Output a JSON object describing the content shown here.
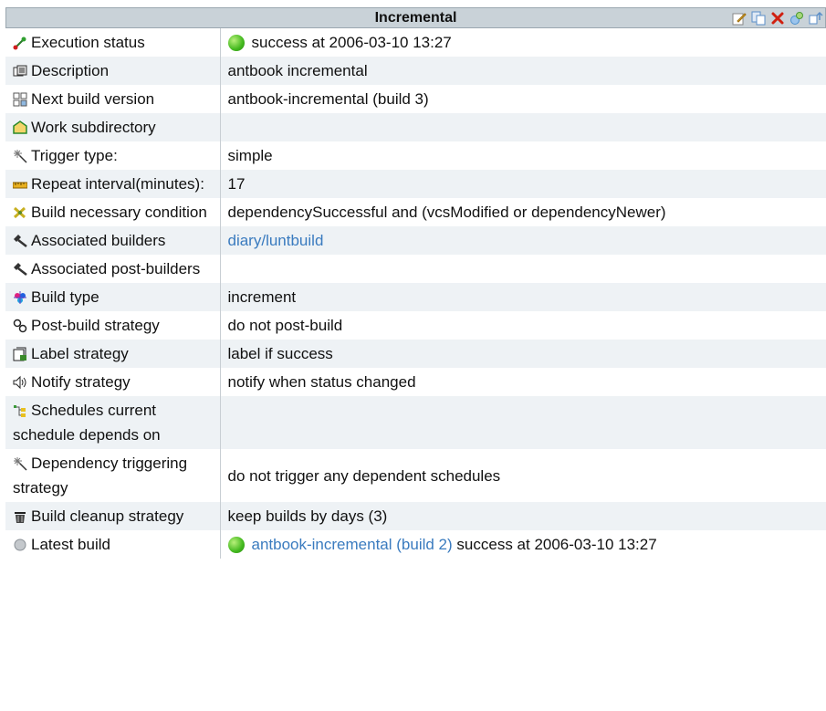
{
  "panel": {
    "title": "Incremental",
    "toolbar": [
      {
        "name": "edit-icon",
        "color": "#e8b83a"
      },
      {
        "name": "copy-icon",
        "color": "#5b8fc9"
      },
      {
        "name": "delete-icon",
        "color": "#d02010"
      },
      {
        "name": "build-icon",
        "color": "#4a90d0"
      },
      {
        "name": "move-icon",
        "color": "#5b8fc9"
      }
    ]
  },
  "rows": [
    {
      "label": "Execution status",
      "icon": "status-icon",
      "value_status": "success",
      "value": "success at 2006-03-10 13:27"
    },
    {
      "label": "Description",
      "icon": "description-icon",
      "value": "antbook incremental"
    },
    {
      "label": "Next build version",
      "icon": "version-icon",
      "value": "antbook-incremental (build 3)"
    },
    {
      "label": "Work subdirectory",
      "icon": "folder-icon",
      "value": ""
    },
    {
      "label": "Trigger type:",
      "icon": "trigger-icon",
      "value": "simple"
    },
    {
      "label": "Repeat interval(minutes):",
      "icon": "ruler-icon",
      "value": "17"
    },
    {
      "label": "Build necessary condition",
      "icon": "condition-icon",
      "value": "dependencySuccessful and (vcsModified or dependencyNewer)"
    },
    {
      "label": "Associated builders",
      "icon": "hammer-icon",
      "value": "diary/luntbuild",
      "value_is_link": true
    },
    {
      "label": "Associated post-builders",
      "icon": "hammer-icon",
      "value": ""
    },
    {
      "label": "Build type",
      "icon": "build-type-icon",
      "value": "increment"
    },
    {
      "label": "Post-build strategy",
      "icon": "gears-icon",
      "value": "do not post-build"
    },
    {
      "label": "Label strategy",
      "icon": "label-icon",
      "value": "label if success"
    },
    {
      "label": "Notify strategy",
      "icon": "speaker-icon",
      "value": "notify when status changed"
    },
    {
      "label": "Schedules current schedule depends on",
      "icon": "schedule-icon",
      "value": ""
    },
    {
      "label": "Dependency triggering strategy",
      "icon": "trigger-icon",
      "value": "do not trigger any dependent schedules"
    },
    {
      "label": "Build cleanup strategy",
      "icon": "trash-icon",
      "value": "keep builds by days (3)"
    },
    {
      "label": "Latest build",
      "icon": "latest-build-icon",
      "value_status": "success",
      "value_link": "antbook-incremental (build 2)",
      "value": "success at 2006-03-10 13:27"
    }
  ]
}
